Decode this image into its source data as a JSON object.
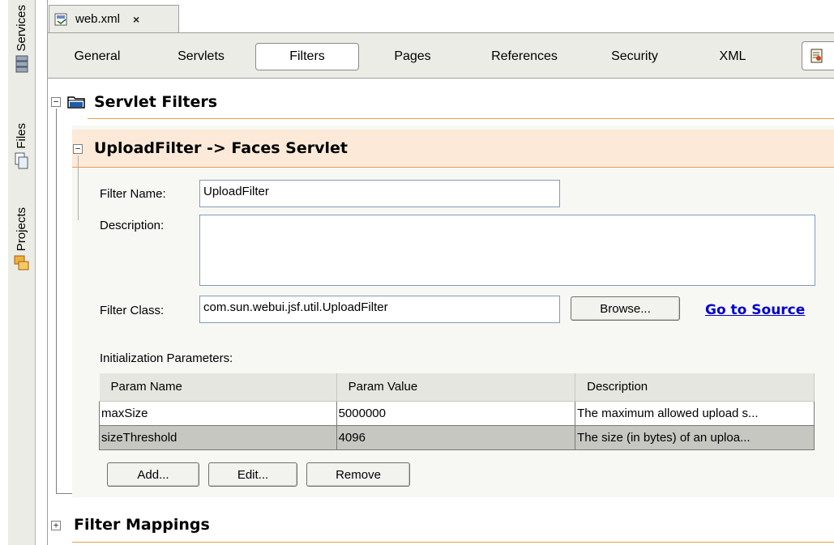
{
  "side_panels": [
    {
      "label": "Services",
      "icon": "services-icon"
    },
    {
      "label": "Files",
      "icon": "files-icon"
    },
    {
      "label": "Projects",
      "icon": "projects-icon"
    }
  ],
  "file_tab": {
    "label": "web.xml",
    "close": "×"
  },
  "view_tabs": {
    "general": "General",
    "servlets": "Servlets",
    "filters": "Filters",
    "pages": "Pages",
    "references": "References",
    "security": "Security",
    "xml": "XML"
  },
  "servlet_filters": {
    "title": "Servlet Filters",
    "expander": "−"
  },
  "filter_panel": {
    "title": "UploadFilter -> Faces Servlet",
    "expander": "−",
    "filter_name_label": "Filter Name:",
    "filter_name_value": "UploadFilter",
    "description_label": "Description:",
    "description_value": "",
    "filter_class_label": "Filter Class:",
    "filter_class_value": "com.sun.webui.jsf.util.UploadFilter",
    "browse_label": "Browse...",
    "goto_source_label": "Go to Source",
    "init_params_label": "Initialization Parameters:",
    "columns": [
      "Param Name",
      "Param Value",
      "Description"
    ],
    "rows": [
      [
        "maxSize",
        "5000000",
        "The maximum allowed upload s..."
      ],
      [
        "sizeThreshold",
        "4096",
        "The size (in bytes) of an uploa..."
      ]
    ],
    "add_label": "Add...",
    "edit_label": "Edit...",
    "remove_label": "Remove"
  },
  "filter_mappings": {
    "title": "Filter Mappings",
    "expander": "+"
  },
  "colors": {
    "accent_orange": "#e6a046",
    "header_bg": "#fde9d8",
    "link": "#0000d0"
  }
}
